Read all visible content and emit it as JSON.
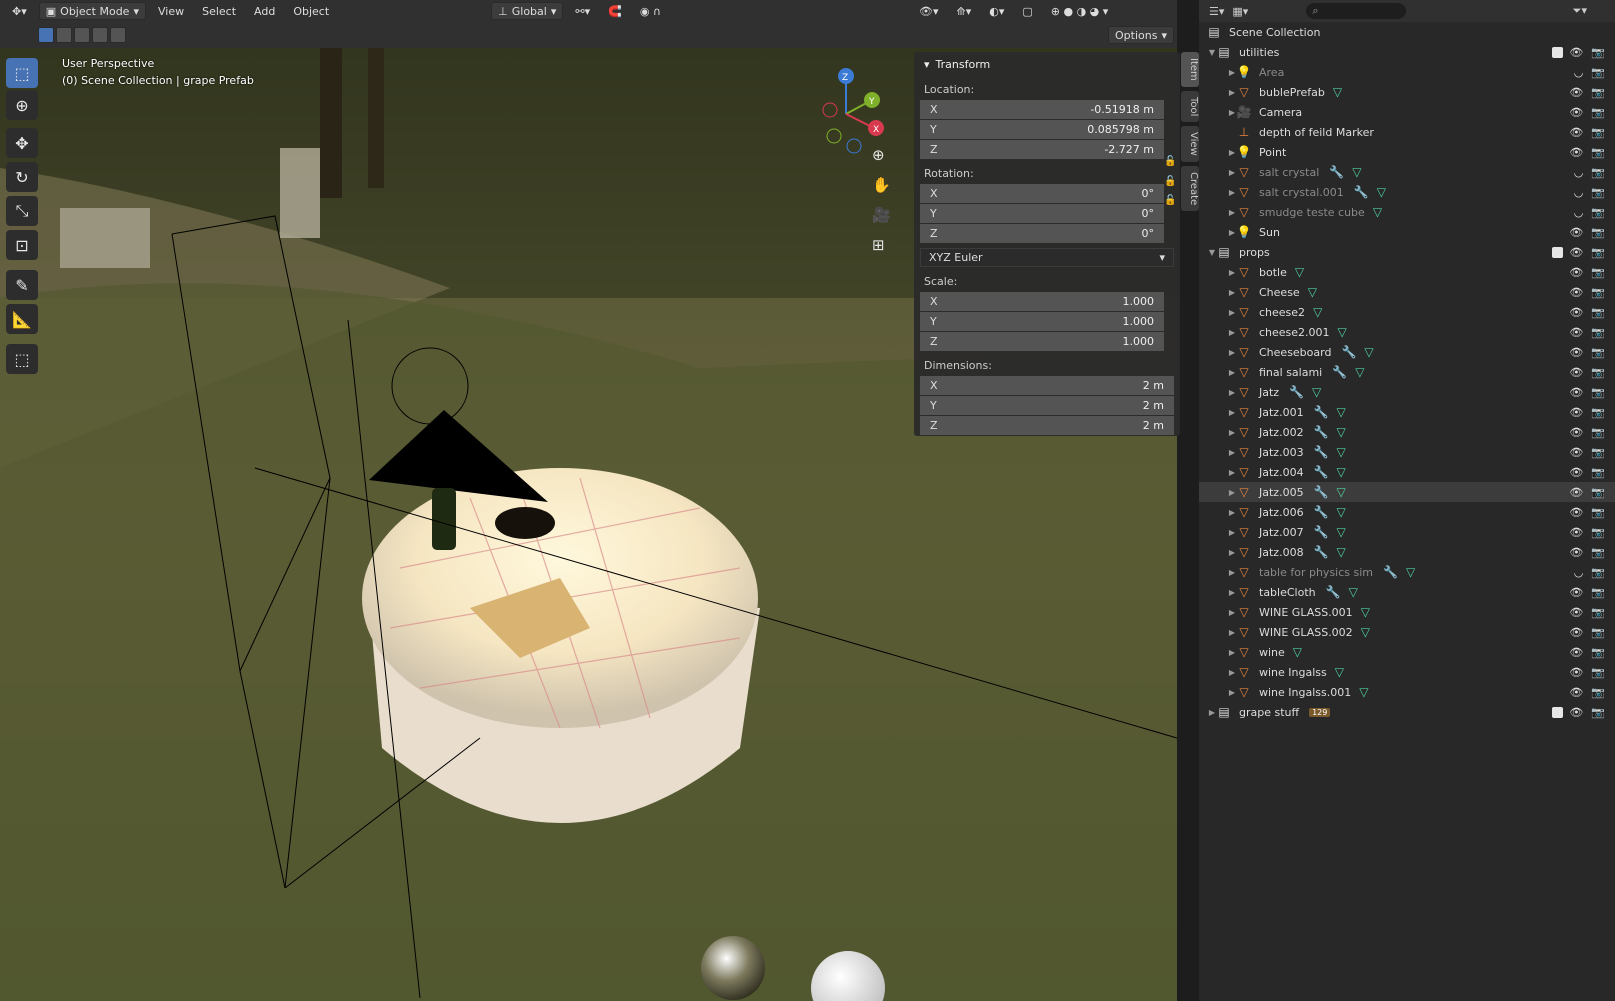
{
  "header": {
    "mode": "Object Mode",
    "menus": [
      "View",
      "Select",
      "Add",
      "Object"
    ],
    "orientation": "Global",
    "options": "Options"
  },
  "viewport": {
    "perspective": "User Perspective",
    "collection": "(0) Scene Collection | grape Prefab"
  },
  "transform": {
    "title": "Transform",
    "location_label": "Location:",
    "location": [
      {
        "axis": "X",
        "value": "-0.51918 m"
      },
      {
        "axis": "Y",
        "value": "0.085798 m"
      },
      {
        "axis": "Z",
        "value": "-2.727 m"
      }
    ],
    "rotation_label": "Rotation:",
    "rotation": [
      {
        "axis": "X",
        "value": "0°"
      },
      {
        "axis": "Y",
        "value": "0°"
      },
      {
        "axis": "Z",
        "value": "0°"
      }
    ],
    "rotation_mode": "XYZ Euler",
    "scale_label": "Scale:",
    "scale": [
      {
        "axis": "X",
        "value": "1.000"
      },
      {
        "axis": "Y",
        "value": "1.000"
      },
      {
        "axis": "Z",
        "value": "1.000"
      }
    ],
    "dimensions_label": "Dimensions:",
    "dimensions": [
      {
        "axis": "X",
        "value": "2 m"
      },
      {
        "axis": "Y",
        "value": "2 m"
      },
      {
        "axis": "Z",
        "value": "2 m"
      }
    ]
  },
  "sidetabs": [
    "Item",
    "Tool",
    "View",
    "Create"
  ],
  "outliner": {
    "root": "Scene Collection",
    "rows": [
      {
        "name": "utilities",
        "type": "collection",
        "level": 0,
        "expanded": true
      },
      {
        "name": "Area",
        "type": "light",
        "level": 1,
        "dim": true
      },
      {
        "name": "bublePrefab",
        "type": "mesh",
        "level": 1,
        "mesh": true
      },
      {
        "name": "Camera",
        "type": "camera",
        "level": 1
      },
      {
        "name": "depth of feild Marker",
        "type": "empty",
        "level": 1
      },
      {
        "name": "Point",
        "type": "light",
        "level": 1
      },
      {
        "name": "salt crystal",
        "type": "mesh",
        "level": 1,
        "dim": true,
        "mod": true,
        "mesh": true
      },
      {
        "name": "salt crystal.001",
        "type": "mesh",
        "level": 1,
        "dim": true,
        "mod": true,
        "mesh": true
      },
      {
        "name": "smudge teste cube",
        "type": "mesh",
        "level": 1,
        "dim": true,
        "mesh": true
      },
      {
        "name": "Sun",
        "type": "light",
        "level": 1
      },
      {
        "name": "props",
        "type": "collection",
        "level": 0,
        "expanded": true
      },
      {
        "name": "botle",
        "type": "mesh",
        "level": 1,
        "mesh": true
      },
      {
        "name": "Cheese",
        "type": "mesh",
        "level": 1,
        "mesh": true
      },
      {
        "name": "cheese2",
        "type": "mesh",
        "level": 1,
        "mesh": true
      },
      {
        "name": "cheese2.001",
        "type": "mesh",
        "level": 1,
        "mesh": true
      },
      {
        "name": "Cheeseboard",
        "type": "mesh",
        "level": 1,
        "mod": true,
        "mesh": true
      },
      {
        "name": "final salami",
        "type": "mesh",
        "level": 1,
        "mod": true,
        "mesh": true
      },
      {
        "name": "Jatz",
        "type": "mesh",
        "level": 1,
        "mod": true,
        "mesh": true
      },
      {
        "name": "Jatz.001",
        "type": "mesh",
        "level": 1,
        "mod": true,
        "mesh": true
      },
      {
        "name": "Jatz.002",
        "type": "mesh",
        "level": 1,
        "mod": true,
        "mesh": true
      },
      {
        "name": "Jatz.003",
        "type": "mesh",
        "level": 1,
        "mod": true,
        "mesh": true
      },
      {
        "name": "Jatz.004",
        "type": "mesh",
        "level": 1,
        "mod": true,
        "mesh": true
      },
      {
        "name": "Jatz.005",
        "type": "mesh",
        "level": 1,
        "mod": true,
        "mesh": true,
        "selected": true
      },
      {
        "name": "Jatz.006",
        "type": "mesh",
        "level": 1,
        "mod": true,
        "mesh": true
      },
      {
        "name": "Jatz.007",
        "type": "mesh",
        "level": 1,
        "mod": true,
        "mesh": true
      },
      {
        "name": "Jatz.008",
        "type": "mesh",
        "level": 1,
        "mod": true,
        "mesh": true
      },
      {
        "name": "table for physics sim",
        "type": "mesh",
        "level": 1,
        "dim": true,
        "mod": true,
        "mesh": true
      },
      {
        "name": "tableCloth",
        "type": "mesh",
        "level": 1,
        "mod": true,
        "mesh": true
      },
      {
        "name": "WINE GLASS.001",
        "type": "mesh",
        "level": 1,
        "mesh": true
      },
      {
        "name": "WINE GLASS.002",
        "type": "mesh",
        "level": 1,
        "mesh": true
      },
      {
        "name": "wine",
        "type": "mesh",
        "level": 1,
        "mesh": true
      },
      {
        "name": "wine Ingalss",
        "type": "mesh",
        "level": 1,
        "mesh": true
      },
      {
        "name": "wine Ingalss.001",
        "type": "mesh",
        "level": 1,
        "mesh": true
      },
      {
        "name": "grape stuff",
        "type": "collection",
        "level": 0,
        "expanded": false,
        "badge": "129"
      }
    ]
  }
}
